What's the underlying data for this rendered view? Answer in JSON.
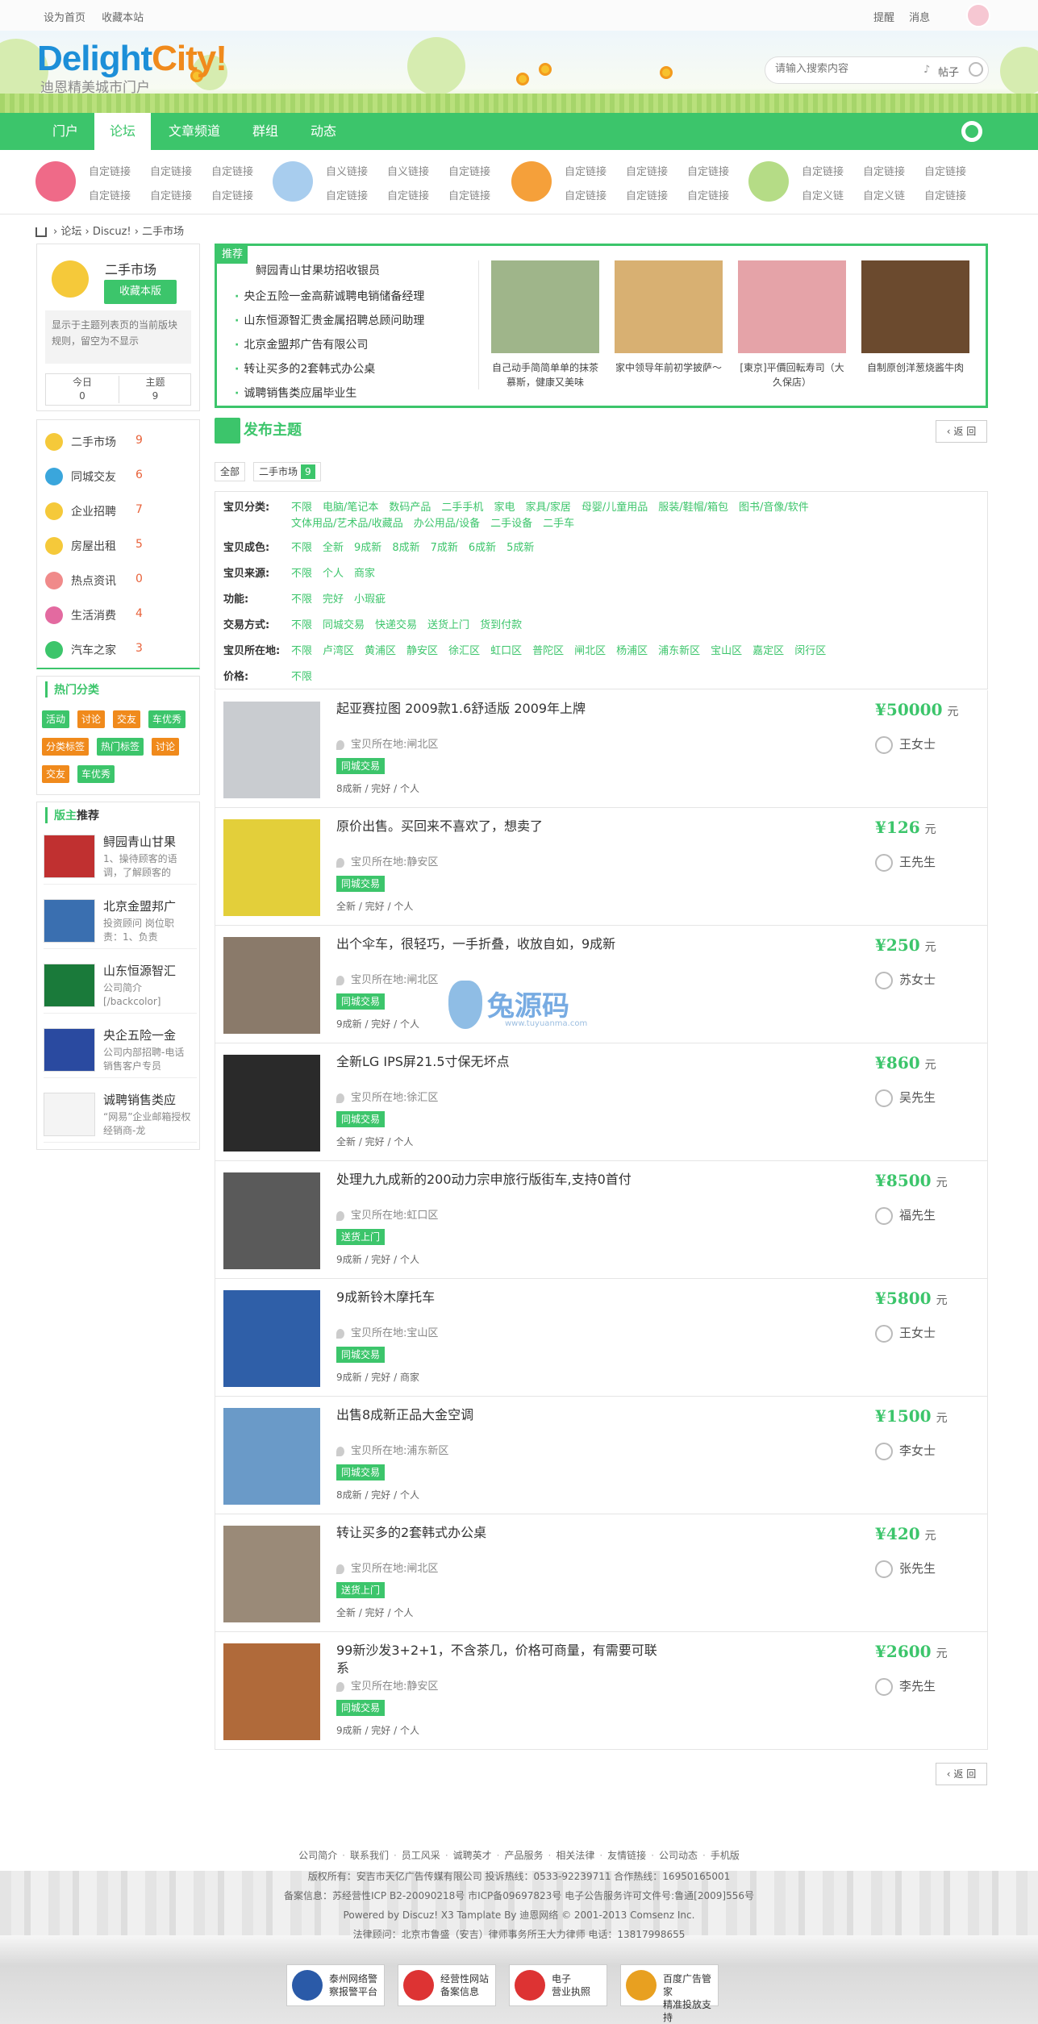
{
  "topbar": {
    "set_home": "设为首页",
    "bookmark": "收藏本站",
    "remind": "提醒",
    "message": "消息"
  },
  "header": {
    "logo_a": "Delight",
    "logo_b": "City",
    "logo_c": "!",
    "tagline": "迪恩精美城市门户",
    "search_placeholder": "请输入搜索内容",
    "search_scope": "帖子"
  },
  "nav": [
    "门户",
    "论坛",
    "文章频道",
    "群组",
    "动态"
  ],
  "subnav_links": [
    [
      "自定链接",
      "自定链接",
      "自定链接",
      "自定链接",
      "自定链接",
      "自定链接"
    ],
    [
      "自义链接",
      "自义链接",
      "自定链接",
      "自定链接",
      "自定链接",
      "自定链接"
    ],
    [
      "自定链接",
      "自定链接",
      "自定链接",
      "自定链接",
      "自定链接",
      "自定链接"
    ],
    [
      "自定链接",
      "自定链接",
      "自定链接",
      "自定义链",
      "自定义链",
      "自定链接"
    ]
  ],
  "breadcrumb": [
    "论坛",
    "Discuz!",
    "二手市场"
  ],
  "forum": {
    "title": "二手市场",
    "fav_button": "收藏本版",
    "desc": "显示于主题列表页的当前版块规则，留空为不显示",
    "today_label": "今日",
    "today": "0",
    "topics_label": "主题",
    "topics": "9"
  },
  "categories": [
    {
      "name": "二手市场",
      "count": "9",
      "color": "#f5c93a"
    },
    {
      "name": "同城交友",
      "count": "6",
      "color": "#3aa6dc"
    },
    {
      "name": "企业招聘",
      "count": "7",
      "color": "#f5c93a"
    },
    {
      "name": "房屋出租",
      "count": "5",
      "color": "#f5c93a"
    },
    {
      "name": "热点资讯",
      "count": "0",
      "color": "#f08a8a"
    },
    {
      "name": "生活消费",
      "count": "4",
      "color": "#e36aa0"
    },
    {
      "name": "汽车之家",
      "count": "3",
      "color": "#3cc56b"
    }
  ],
  "hot": {
    "title": "热门分类",
    "tags": [
      {
        "label": "活动",
        "color": "#3cc56b"
      },
      {
        "label": "讨论",
        "color": "#f08a1c"
      },
      {
        "label": "交友",
        "color": "#f08a1c"
      },
      {
        "label": "车优秀",
        "color": "#3cc56b"
      },
      {
        "label": "分类标签",
        "color": "#f08a1c"
      },
      {
        "label": "热门标签",
        "color": "#3cc56b"
      },
      {
        "label": "讨论",
        "color": "#f08a1c"
      },
      {
        "label": "交友",
        "color": "#f08a1c"
      },
      {
        "label": "车优秀",
        "color": "#3cc56b"
      }
    ]
  },
  "moderator": {
    "title_a": "版主",
    "title_b": "推荐",
    "items": [
      {
        "title": "鲟园青山甘果",
        "desc": "1、操待顾客的语调，了解顾客的"
      },
      {
        "title": "北京金盟邦广",
        "desc": "投资顾问 岗位职责：1、负责"
      },
      {
        "title": "山东恒源智汇",
        "desc": "公司简介 [/backcolor] [/backco"
      },
      {
        "title": "央企五险一金",
        "desc": "公司内部招聘-电话销售客户专员"
      },
      {
        "title": "诚聘销售类应",
        "desc": "“网易”企业邮箱授权经销商-龙"
      }
    ]
  },
  "recommend": {
    "badge": "推荐",
    "headline": "鲟园青山甘果坊招收银员",
    "items": [
      "央企五险一金高薪诚聘电销储备经理",
      "山东恒源智汇贵金属招聘总顾问助理",
      "北京金盟邦广告有限公司",
      "转让买多的2套韩式办公桌",
      "诚聘销售类应届毕业生"
    ],
    "pics": [
      {
        "caption": "自己动手简简单单的抹茶慕斯，健康又美味",
        "color": "#9fb58a"
      },
      {
        "caption": "家中领导年前初学披萨～",
        "color": "#d8b072"
      },
      {
        "caption": "[東京]平價回転寿司（大久保店）",
        "color": "#e5a3a8"
      },
      {
        "caption": "自制原创洋葱烧酱牛肉",
        "color": "#6b4a2e"
      }
    ]
  },
  "post_button": "发布主题",
  "back_label": "返 回",
  "filter_tabs": {
    "all": "全部",
    "current": "二手市场",
    "count": "9"
  },
  "filters": [
    {
      "label": "宝贝分类:",
      "values": [
        "不限",
        "电脑/笔记本",
        "数码产品",
        "二手手机",
        "家电",
        "家具/家居",
        "母婴/儿童用品",
        "服装/鞋帽/箱包",
        "图书/音像/软件",
        "文体用品/艺术品/收藏品",
        "办公用品/设备",
        "二手设备",
        "二手车"
      ]
    },
    {
      "label": "宝贝成色:",
      "values": [
        "不限",
        "全新",
        "9成新",
        "8成新",
        "7成新",
        "6成新",
        "5成新"
      ]
    },
    {
      "label": "宝贝来源:",
      "values": [
        "不限",
        "个人",
        "商家"
      ]
    },
    {
      "label": "功能:",
      "values": [
        "不限",
        "完好",
        "小瑕疵"
      ]
    },
    {
      "label": "交易方式:",
      "values": [
        "不限",
        "同城交易",
        "快递交易",
        "送货上门",
        "货到付款"
      ]
    },
    {
      "label": "宝贝所在地:",
      "values": [
        "不限",
        "卢湾区",
        "黄浦区",
        "静安区",
        "徐汇区",
        "虹口区",
        "普陀区",
        "闸北区",
        "杨浦区",
        "浦东新区",
        "宝山区",
        "嘉定区",
        "闵行区"
      ]
    },
    {
      "label": "价格:",
      "values": [
        "不限"
      ]
    }
  ],
  "listings": [
    {
      "title": "起亚赛拉图 2009款1.6舒适版 2009年上牌",
      "loc": "宝贝所在地:闸北区",
      "trade": "同城交易",
      "cond": "8成新 / 完好 / 个人",
      "price": "¥50000",
      "seller": "王女士",
      "color": "#c9ccd0"
    },
    {
      "title": "原价出售。买回来不喜欢了，想卖了",
      "loc": "宝贝所在地:静安区",
      "trade": "同城交易",
      "cond": "全新 / 完好 / 个人",
      "price": "¥126",
      "seller": "王先生",
      "color": "#e3cf3a"
    },
    {
      "title": "出个伞车，很轻巧，一手折叠，收放自如，9成新",
      "loc": "宝贝所在地:闸北区",
      "trade": "同城交易",
      "cond": "9成新 / 完好 / 个人",
      "price": "¥250",
      "seller": "苏女士",
      "color": "#8a7a6a"
    },
    {
      "title": "全新LG IPS屏21.5寸保无坏点",
      "loc": "宝贝所在地:徐汇区",
      "trade": "同城交易",
      "cond": "全新 / 完好 / 个人",
      "price": "¥860",
      "seller": "吴先生",
      "color": "#2a2a2a"
    },
    {
      "title": "处理九九成新的200动力宗申旅行版街车,支持0首付",
      "loc": "宝贝所在地:虹口区",
      "trade": "送货上门",
      "cond": "9成新 / 完好 / 个人",
      "price": "¥8500",
      "seller": "福先生",
      "color": "#5a5a5a"
    },
    {
      "title": "9成新铃木摩托车",
      "loc": "宝贝所在地:宝山区",
      "trade": "同城交易",
      "cond": "9成新 / 完好 / 商家",
      "price": "¥5800",
      "seller": "王女士",
      "color": "#2f5fa8"
    },
    {
      "title": "出售8成新正品大金空调",
      "loc": "宝贝所在地:浦东新区",
      "trade": "同城交易",
      "cond": "8成新 / 完好 / 个人",
      "price": "¥1500",
      "seller": "李女士",
      "color": "#6a9ac8"
    },
    {
      "title": "转让买多的2套韩式办公桌",
      "loc": "宝贝所在地:闸北区",
      "trade": "送货上门",
      "cond": "全新 / 完好 / 个人",
      "price": "¥420",
      "seller": "张先生",
      "color": "#9a8a78"
    },
    {
      "title": "99新沙发3+2+1，不含茶几，价格可商量，有需要可联系",
      "loc": "宝贝所在地:静安区",
      "trade": "同城交易",
      "cond": "9成新 / 完好 / 个人",
      "price": "¥2600",
      "seller": "李先生",
      "color": "#b06a3a"
    }
  ],
  "yuan": "元",
  "watermark": {
    "name": "兔源码",
    "url": "www.tuyuanma.com"
  },
  "footer": {
    "links": [
      "公司简介",
      "联系我们",
      "员工风采",
      "诚聘英才",
      "产品服务",
      "相关法律",
      "友情链接",
      "公司动态",
      "手机版"
    ],
    "line2": "版权所有：安吉市天亿广告传媒有限公司 投诉热线：0533-92239711 合作热线：16950165001",
    "line3": "备案信息：苏经营性ICP B2-20090218号 市ICP备09697823号 电子公告服务许可文件号:鲁通[2009]556号",
    "line4": "Powered by Discuz! X3 Tamplate By 迪恩网络 © 2001-2013 Comsenz Inc.",
    "line5": "法律顾问：北京市鲁盛（安吉）律师事务所王大力律师 电话：13817998655",
    "badges": [
      {
        "a": "泰州网络警",
        "b": "察报警平台",
        "color": "#2a5aa8"
      },
      {
        "a": "经营性网站",
        "b": "备案信息",
        "color": "#d33"
      },
      {
        "a": "电子",
        "b": "营业执照",
        "color": "#d33"
      },
      {
        "a": "百度广告管家",
        "b": "精准投放支持",
        "color": "#e8a020"
      }
    ]
  }
}
